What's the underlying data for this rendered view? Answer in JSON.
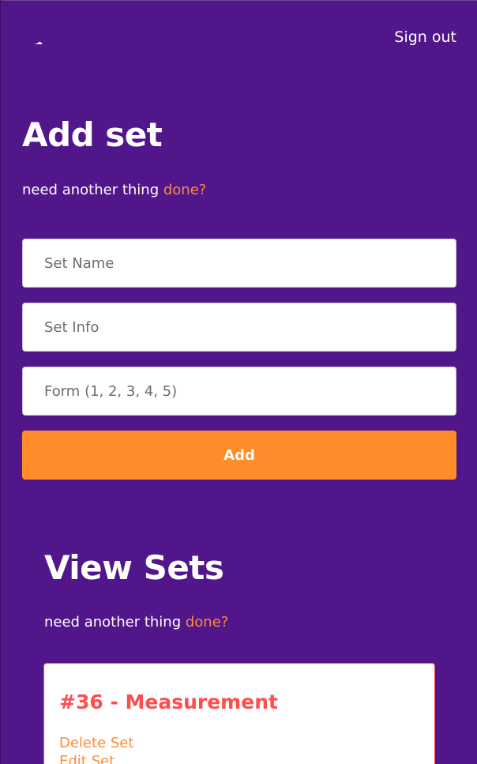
{
  "header": {
    "logo_icon": "app-logo-icon",
    "signout_label": "Sign out"
  },
  "add_section": {
    "title": "Add set",
    "tagline_text": "need another thing ",
    "tagline_accent": "done?",
    "fields": [
      {
        "placeholder": "Set Name",
        "value": ""
      },
      {
        "placeholder": "Set Info",
        "value": ""
      },
      {
        "placeholder": "Form (1, 2, 3, 4, 5)",
        "value": ""
      }
    ],
    "add_label": "Add"
  },
  "view_section": {
    "title": "View Sets",
    "tagline_text": "need another thing ",
    "tagline_accent": "done?",
    "sets": [
      {
        "title": "#36 - Measurement",
        "delete_label": "Delete Set",
        "edit_label": "Edit Set"
      }
    ]
  },
  "colors": {
    "background": "#51168a",
    "accent_orange": "#ff8c28",
    "card_red": "#ff4d4d"
  }
}
